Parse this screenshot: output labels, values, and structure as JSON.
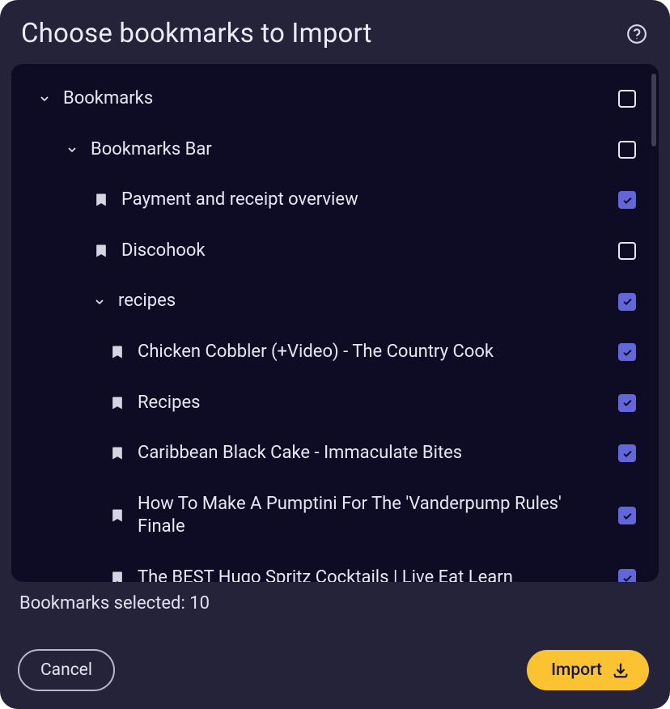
{
  "header": {
    "title": "Choose bookmarks to Import"
  },
  "tree": [
    {
      "id": "root",
      "indent": 0,
      "kind": "folder",
      "label": "Bookmarks",
      "checked": false
    },
    {
      "id": "bar",
      "indent": 1,
      "kind": "folder",
      "label": "Bookmarks Bar",
      "checked": false
    },
    {
      "id": "pay",
      "indent": 2,
      "kind": "bookmark",
      "label": "Payment and receipt overview",
      "checked": true
    },
    {
      "id": "disco",
      "indent": 2,
      "kind": "bookmark",
      "label": "Discohook",
      "checked": false
    },
    {
      "id": "recipes",
      "indent": 2,
      "kind": "folder",
      "label": "recipes",
      "checked": true
    },
    {
      "id": "cobbler",
      "indent": 3,
      "kind": "bookmark",
      "label": "Chicken Cobbler (+Video) - The Country Cook",
      "checked": true
    },
    {
      "id": "recipes2",
      "indent": 3,
      "kind": "bookmark",
      "label": "Recipes",
      "checked": true
    },
    {
      "id": "blackcake",
      "indent": 3,
      "kind": "bookmark",
      "label": "Caribbean Black Cake - Immaculate Bites",
      "checked": true
    },
    {
      "id": "pumptini",
      "indent": 3,
      "kind": "bookmark",
      "label": "How To Make A Pumptini For The 'Vanderpump Rules' Finale",
      "checked": true
    },
    {
      "id": "hugo",
      "indent": 3,
      "kind": "bookmark",
      "label": "The BEST Hugo Spritz Cocktails | Live Eat Learn",
      "checked": true
    }
  ],
  "footer": {
    "selected_label": "Bookmarks selected: 10",
    "cancel_label": "Cancel",
    "import_label": "Import"
  }
}
